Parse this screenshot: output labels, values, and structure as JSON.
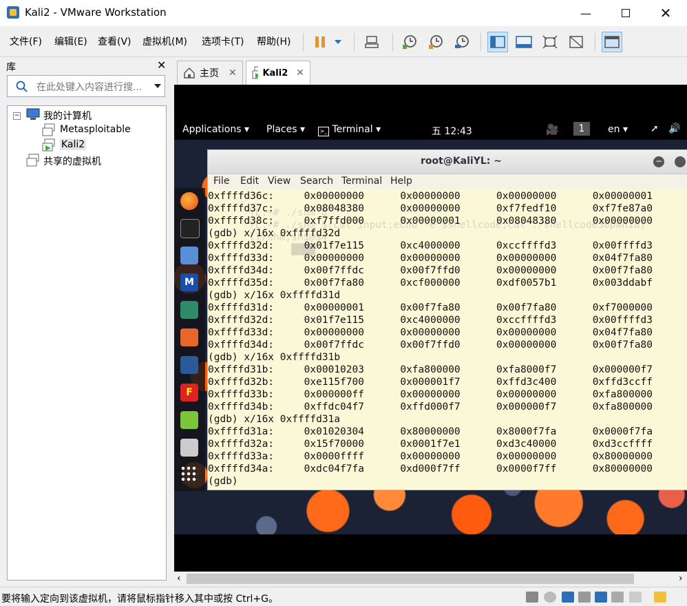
{
  "window": {
    "title": "Kali2 - VMware Workstation"
  },
  "menubar": {
    "items": [
      "文件(F)",
      "编辑(E)",
      "查看(V)",
      "虚拟机(M)",
      "选项卡(T)",
      "帮助(H)"
    ]
  },
  "library": {
    "title": "库",
    "search_placeholder": "在此处键入内容进行搜...",
    "tree": {
      "root": "我的计算机",
      "children": [
        "Metasploitable",
        "Kali2"
      ],
      "shared": "共享的虚拟机"
    }
  },
  "tabs": [
    {
      "label": "主页",
      "active": false
    },
    {
      "label": "Kali2",
      "active": true
    }
  ],
  "kali": {
    "topbar": {
      "applications": "Applications",
      "places": "Places",
      "terminal": "Terminal",
      "clock": "五 12:43",
      "workspace": "1",
      "lang": "en"
    },
    "terminal": {
      "title": "root@KaliYL: ~",
      "menu": [
        "File",
        "Edit",
        "View",
        "Search",
        "Terminal",
        "Help"
      ],
      "ghost_lines": [
        "",
        "YL:~# ./shm 8",
        "YL:~# ./shm $(cat input;echo -e $shellcode;cat ./shellcode38pwn18)",
        "ll/shm,sh$@$4",
        "       ████"
      ],
      "lines": [
        "0xffffd36c:     0x00000000      0x00000000      0x00000000      0x00000001",
        "0xffffd37c:     0x08048380      0x00000000      0xf7fedf10      0xf7fe87a0",
        "0xffffd38c:     0xf7ffd000      0x00000001      0x08048380      0x00000000",
        "(gdb) x/16x 0xffffd32d",
        "0xffffd32d:     0x01f7e115      0xc4000000      0xccffffd3      0x00ffffd3",
        "0xffffd33d:     0x00000000      0x00000000      0x00000000      0x04f7fa80",
        "0xffffd34d:     0x00f7ffdc      0x00f7ffd0      0x00000000      0x00f7fa80",
        "0xffffd35d:     0x00f7fa80      0xcf000000      0xdf0057b1      0x003ddabf",
        "(gdb) x/16x 0xffffd31d",
        "0xffffd31d:     0x00000001      0x00f7fa80      0x00f7fa80      0xf7000000",
        "0xffffd32d:     0x01f7e115      0xc4000000      0xccffffd3      0x00ffffd3",
        "0xffffd33d:     0x00000000      0x00000000      0x00000000      0x04f7fa80",
        "0xffffd34d:     0x00f7ffdc      0x00f7ffd0      0x00000000      0x00f7fa80",
        "(gdb) x/16x 0xffffd31b",
        "0xffffd31b:     0x00010203      0xfa800000      0xfa8000f7      0x000000f7",
        "0xffffd32b:     0xe115f700      0x000001f7      0xffd3c400      0xffd3ccff",
        "0xffffd33b:     0x000000ff      0x00000000      0x00000000      0xfa800000",
        "0xffffd34b:     0xffdc04f7      0xffd000f7      0x000000f7      0xfa800000",
        "(gdb) x/16x 0xffffd31a",
        "0xffffd31a:     0x01020304      0x80000000      0x8000f7fa      0x0000f7fa",
        "0xffffd32a:     0x15f70000      0x0001f7e1      0xd3c40000      0xd3ccffff",
        "0xffffd33a:     0x0000ffff      0x00000000      0x00000000      0x80000000",
        "0xffffd34a:     0xdc04f7fa      0xd000f7ff      0x0000f7ff      0x80000000",
        "(gdb)"
      ]
    }
  },
  "statusbar": {
    "text": "要将输入定向到该虚拟机，请将鼠标指针移入其中或按 Ctrl+G。"
  },
  "colors": {
    "accent": "#2d6fb5",
    "terminal_bg": "#fbf8d8",
    "pause": "#e8922c"
  }
}
